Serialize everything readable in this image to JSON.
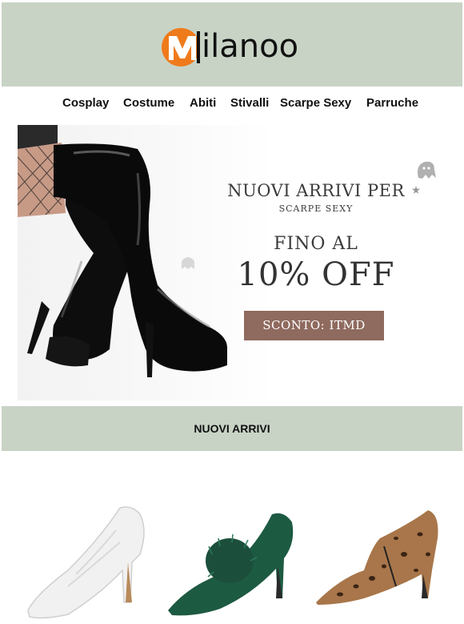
{
  "brand": {
    "name": "Milanoo",
    "logo_text": "ilanoo",
    "logo_color": "#ef7a1a"
  },
  "colors": {
    "header_bg": "#c8d3c6",
    "coupon_bg": "#8f6a5e"
  },
  "nav": {
    "items": [
      {
        "label": "Cosplay"
      },
      {
        "label": "Costume"
      },
      {
        "label": "Abiti"
      },
      {
        "label": "Stivalli"
      },
      {
        "label": "Scarpe Sexy"
      },
      {
        "label": "Parruche"
      }
    ]
  },
  "banner": {
    "line1": "NUOVI ARRIVI PER",
    "line2": "SCARPE SEXY",
    "line3": "FINO AL",
    "line4": "10% OFF",
    "coupon": "SCONTO: ITMD"
  },
  "section": {
    "title": "NUOVI ARRIVI"
  },
  "products": [
    {
      "name": "white-pump",
      "color": "#f2f2f2"
    },
    {
      "name": "green-fur-pump",
      "color": "#1f5a43"
    },
    {
      "name": "leopard-bootie",
      "color": "#a8764a"
    }
  ]
}
